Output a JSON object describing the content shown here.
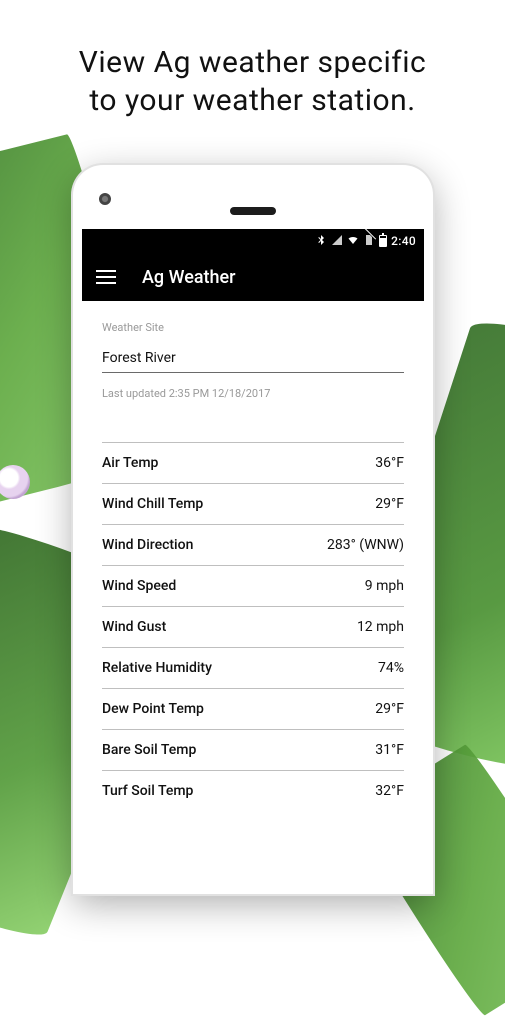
{
  "promo": {
    "line1": "View Ag weather specific",
    "line2": "to your weather station."
  },
  "statusbar": {
    "time": "2:40"
  },
  "appbar": {
    "title": "Ag Weather"
  },
  "site": {
    "label": "Weather Site",
    "value": "Forest River",
    "updated": "Last updated 2:35 PM 12/18/2017"
  },
  "weather": {
    "rows": [
      {
        "label": "Air Temp",
        "value": "36°F"
      },
      {
        "label": "Wind Chill Temp",
        "value": "29°F"
      },
      {
        "label": "Wind Direction",
        "value": "283° (WNW)"
      },
      {
        "label": "Wind Speed",
        "value": "9 mph"
      },
      {
        "label": "Wind Gust",
        "value": "12 mph"
      },
      {
        "label": "Relative Humidity",
        "value": "74%"
      },
      {
        "label": "Dew Point Temp",
        "value": "29°F"
      },
      {
        "label": "Bare Soil Temp",
        "value": "31°F"
      },
      {
        "label": "Turf Soil Temp",
        "value": "32°F"
      }
    ]
  }
}
